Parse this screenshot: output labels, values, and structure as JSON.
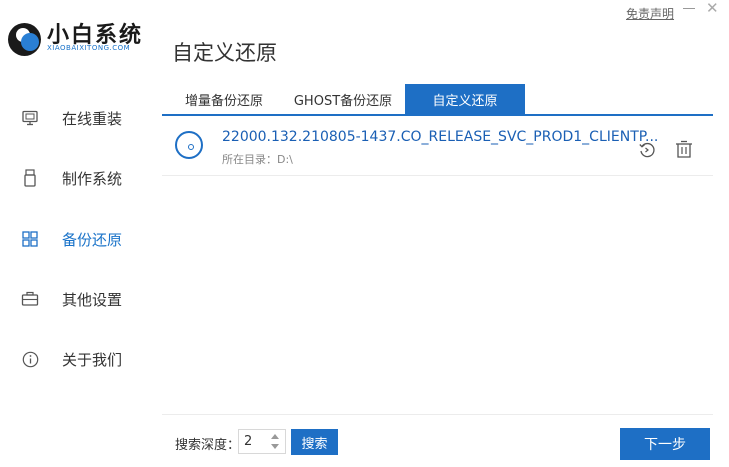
{
  "brand": {
    "title": "小白系统",
    "subtitle": "XIAOBAIXITONG.COM",
    "accent": "#1e6fc5"
  },
  "topbar": {
    "disclaimer": "免责声明",
    "minimize_symbol": "—",
    "close_symbol": "✕"
  },
  "page_title": "自定义还原",
  "sidebar": {
    "items": [
      {
        "label": "在线重装",
        "icon": "monitor-icon",
        "active": false
      },
      {
        "label": "制作系统",
        "icon": "usb-icon",
        "active": false
      },
      {
        "label": "备份还原",
        "icon": "grid-icon",
        "active": true
      },
      {
        "label": "其他设置",
        "icon": "briefcase-icon",
        "active": false
      },
      {
        "label": "关于我们",
        "icon": "info-icon",
        "active": false
      }
    ]
  },
  "tabs": [
    {
      "label": "增量备份还原",
      "active": false
    },
    {
      "label": "GHOST备份还原",
      "active": false
    },
    {
      "label": "自定义还原",
      "active": true
    }
  ],
  "backups": [
    {
      "name": "22000.132.210805-1437.CO_RELEASE_SVC_PROD1_CLIENTP...",
      "dir_label": "所在目录：D:\\",
      "icon": "disc-icon"
    }
  ],
  "row_actions": {
    "restore_icon": "restore-icon",
    "delete_icon": "trash-icon"
  },
  "footer": {
    "depth_label": "搜索深度：",
    "depth_value": "2",
    "search_label": "搜索",
    "next_label": "下一步"
  }
}
